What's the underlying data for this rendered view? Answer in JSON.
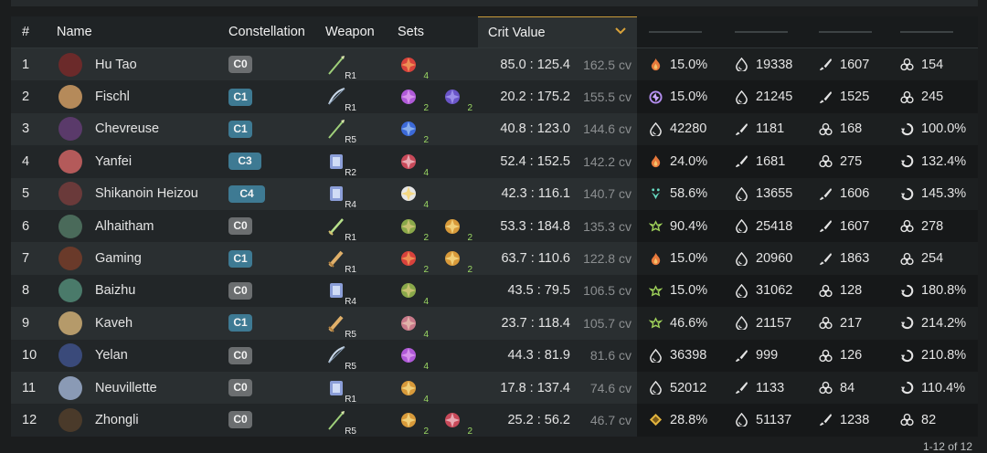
{
  "headers": {
    "num": "#",
    "name": "Name",
    "constellation": "Constellation",
    "weapon": "Weapon",
    "sets": "Sets",
    "crit": "Crit Value"
  },
  "rows": [
    {
      "num": "1",
      "name": "Hu Tao",
      "avatar_color": "#6b2a2a",
      "const": "C0",
      "const_color": "gray",
      "weapon_ref": "R1",
      "weapon_icon": "polearm-icon",
      "sets": [
        {
          "icon": "set-icon-red",
          "count": "4"
        }
      ],
      "crit": "85.0 : 125.4",
      "cv": "162.5 cv",
      "stats": [
        {
          "icon": "pyro-icon",
          "v": "15.0%"
        },
        {
          "icon": "hp-icon",
          "v": "19338"
        },
        {
          "icon": "atk-icon",
          "v": "1607"
        },
        {
          "icon": "em-icon",
          "v": "154"
        }
      ]
    },
    {
      "num": "2",
      "name": "Fischl",
      "avatar_color": "#b58a5a",
      "const": "C1",
      "const_color": "blue",
      "weapon_ref": "R1",
      "weapon_icon": "bow-icon",
      "sets": [
        {
          "icon": "set-icon-purple",
          "count": "2"
        },
        {
          "icon": "set-icon-violet",
          "count": "2"
        }
      ],
      "crit": "20.2 : 175.2",
      "cv": "155.5 cv",
      "stats": [
        {
          "icon": "electro-icon",
          "v": "15.0%"
        },
        {
          "icon": "hp-icon",
          "v": "21245"
        },
        {
          "icon": "atk-icon",
          "v": "1525"
        },
        {
          "icon": "em-icon",
          "v": "245"
        }
      ]
    },
    {
      "num": "3",
      "name": "Chevreuse",
      "avatar_color": "#5a3a6a",
      "const": "C1",
      "const_color": "blue",
      "weapon_ref": "R5",
      "weapon_icon": "polearm-icon",
      "sets": [
        {
          "icon": "set-icon-blue",
          "count": "2"
        }
      ],
      "crit": "40.8 : 123.0",
      "cv": "144.6 cv",
      "stats": [
        {
          "icon": "hp-icon",
          "v": "42280"
        },
        {
          "icon": "atk-icon",
          "v": "1181"
        },
        {
          "icon": "em-icon",
          "v": "168"
        },
        {
          "icon": "er-icon",
          "v": "100.0%"
        }
      ]
    },
    {
      "num": "4",
      "name": "Yanfei",
      "avatar_color": "#b45a5a",
      "const": "C3",
      "const_color": "blue",
      "weapon_ref": "R2",
      "weapon_icon": "catalyst-icon",
      "sets": [
        {
          "icon": "set-icon-crimson",
          "count": "4"
        }
      ],
      "crit": "52.4 : 152.5",
      "cv": "142.2 cv",
      "stats": [
        {
          "icon": "pyro-icon",
          "v": "24.0%"
        },
        {
          "icon": "atk-icon",
          "v": "1681"
        },
        {
          "icon": "em-icon",
          "v": "275"
        },
        {
          "icon": "er-icon",
          "v": "132.4%"
        }
      ]
    },
    {
      "num": "5",
      "name": "Shikanoin Heizou",
      "avatar_color": "#6a3a3a",
      "const": "C4",
      "const_color": "blue",
      "weapon_ref": "R4",
      "weapon_icon": "catalyst-icon",
      "sets": [
        {
          "icon": "set-icon-white",
          "count": "4"
        }
      ],
      "crit": "42.3 : 116.1",
      "cv": "140.7 cv",
      "stats": [
        {
          "icon": "anemo-icon",
          "v": "58.6%"
        },
        {
          "icon": "hp-icon",
          "v": "13655"
        },
        {
          "icon": "atk-icon",
          "v": "1606"
        },
        {
          "icon": "er-icon",
          "v": "145.3%"
        }
      ]
    },
    {
      "num": "6",
      "name": "Alhaitham",
      "avatar_color": "#4a6a5a",
      "const": "C0",
      "const_color": "gray",
      "weapon_ref": "R1",
      "weapon_icon": "sword-icon",
      "sets": [
        {
          "icon": "set-icon-green",
          "count": "2"
        },
        {
          "icon": "set-icon-gold",
          "count": "2"
        }
      ],
      "crit": "53.3 : 184.8",
      "cv": "135.3 cv",
      "stats": [
        {
          "icon": "dendro-icon",
          "v": "90.4%"
        },
        {
          "icon": "hp-icon",
          "v": "25418"
        },
        {
          "icon": "atk-icon",
          "v": "1607"
        },
        {
          "icon": "em-icon",
          "v": "278"
        }
      ]
    },
    {
      "num": "7",
      "name": "Gaming",
      "avatar_color": "#6a3a2a",
      "const": "C1",
      "const_color": "blue",
      "weapon_ref": "R1",
      "weapon_icon": "claymore-icon",
      "sets": [
        {
          "icon": "set-icon-red",
          "count": "2"
        },
        {
          "icon": "set-icon-gold",
          "count": "2"
        }
      ],
      "crit": "63.7 : 110.6",
      "cv": "122.8 cv",
      "stats": [
        {
          "icon": "pyro-icon",
          "v": "15.0%"
        },
        {
          "icon": "hp-icon",
          "v": "20960"
        },
        {
          "icon": "atk-icon",
          "v": "1863"
        },
        {
          "icon": "em-icon",
          "v": "254"
        }
      ]
    },
    {
      "num": "8",
      "name": "Baizhu",
      "avatar_color": "#4a7a6a",
      "const": "C0",
      "const_color": "gray",
      "weapon_ref": "R4",
      "weapon_icon": "catalyst-icon",
      "sets": [
        {
          "icon": "set-icon-green",
          "count": "4"
        }
      ],
      "crit": "43.5 : 79.5",
      "cv": "106.5 cv",
      "stats": [
        {
          "icon": "dendro-icon",
          "v": "15.0%"
        },
        {
          "icon": "hp-icon",
          "v": "31062"
        },
        {
          "icon": "em-icon",
          "v": "128"
        },
        {
          "icon": "er-icon",
          "v": "180.8%"
        }
      ]
    },
    {
      "num": "9",
      "name": "Kaveh",
      "avatar_color": "#b59a6a",
      "const": "C1",
      "const_color": "blue",
      "weapon_ref": "R5",
      "weapon_icon": "claymore-icon",
      "sets": [
        {
          "icon": "set-icon-pink",
          "count": "4"
        }
      ],
      "crit": "23.7 : 118.4",
      "cv": "105.7 cv",
      "stats": [
        {
          "icon": "dendro-icon",
          "v": "46.6%"
        },
        {
          "icon": "hp-icon",
          "v": "21157"
        },
        {
          "icon": "em-icon",
          "v": "217"
        },
        {
          "icon": "er-icon",
          "v": "214.2%"
        }
      ]
    },
    {
      "num": "10",
      "name": "Yelan",
      "avatar_color": "#3a4a7a",
      "const": "C0",
      "const_color": "gray",
      "weapon_ref": "R5",
      "weapon_icon": "bow-icon",
      "sets": [
        {
          "icon": "set-icon-purple",
          "count": "4"
        }
      ],
      "crit": "44.3 : 81.9",
      "cv": "81.6 cv",
      "stats": [
        {
          "icon": "hp-icon",
          "v": "36398"
        },
        {
          "icon": "atk-icon",
          "v": "999"
        },
        {
          "icon": "em-icon",
          "v": "126"
        },
        {
          "icon": "er-icon",
          "v": "210.8%"
        }
      ]
    },
    {
      "num": "11",
      "name": "Neuvillette",
      "avatar_color": "#8a9ab5",
      "const": "C0",
      "const_color": "gray",
      "weapon_ref": "R1",
      "weapon_icon": "catalyst-icon",
      "sets": [
        {
          "icon": "set-icon-gold",
          "count": "4"
        }
      ],
      "crit": "17.8 : 137.4",
      "cv": "74.6 cv",
      "stats": [
        {
          "icon": "hp-icon",
          "v": "52012"
        },
        {
          "icon": "atk-icon",
          "v": "1133"
        },
        {
          "icon": "em-icon",
          "v": "84"
        },
        {
          "icon": "er-icon",
          "v": "110.4%"
        }
      ]
    },
    {
      "num": "12",
      "name": "Zhongli",
      "avatar_color": "#4a3a2a",
      "const": "C0",
      "const_color": "gray",
      "weapon_ref": "R5",
      "weapon_icon": "polearm-icon",
      "sets": [
        {
          "icon": "set-icon-gold",
          "count": "2"
        },
        {
          "icon": "set-icon-crimson",
          "count": "2"
        }
      ],
      "crit": "25.2 : 56.2",
      "cv": "46.7 cv",
      "stats": [
        {
          "icon": "geo-icon",
          "v": "28.8%"
        },
        {
          "icon": "hp-icon",
          "v": "51137"
        },
        {
          "icon": "atk-icon",
          "v": "1238"
        },
        {
          "icon": "em-icon",
          "v": "82"
        }
      ]
    }
  ],
  "footer": "1-12 of 12",
  "colors": {
    "accent": "#c99a3a",
    "badge_blue": "#3e7a93",
    "badge_gray": "#6b6e70"
  }
}
